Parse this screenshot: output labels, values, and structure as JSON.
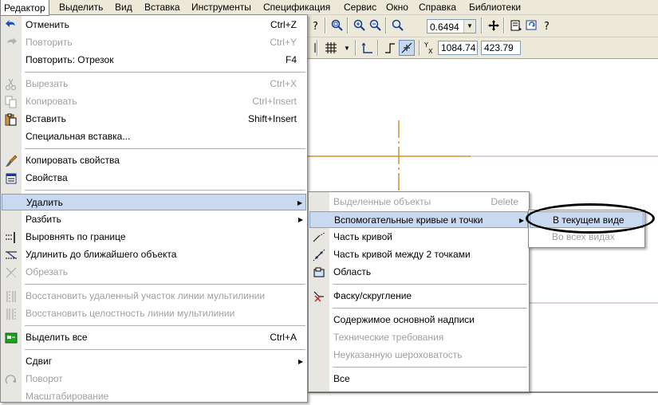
{
  "menubar": {
    "items": [
      "Редактор",
      "Выделить",
      "Вид",
      "Вставка",
      "Инструменты",
      "Спецификация",
      "Сервис",
      "Окно",
      "Справка",
      "Библиотеки"
    ]
  },
  "toolbar": {
    "zoom_value": "0.6494",
    "coord_x": "1084.74",
    "coord_y": "423.79"
  },
  "editor_menu": {
    "items": [
      {
        "label": "Отменить",
        "shortcut": "Ctrl+Z",
        "icon": "undo-icon"
      },
      {
        "label": "Повторить",
        "shortcut": "Ctrl+Y",
        "icon": "redo-icon"
      },
      {
        "label": "Повторить: Отрезок",
        "shortcut": "F4"
      },
      {
        "label": "Вырезать",
        "shortcut": "Ctrl+X",
        "icon": "cut-icon"
      },
      {
        "label": "Копировать",
        "shortcut": "Ctrl+Insert",
        "icon": "copy-icon"
      },
      {
        "label": "Вставить",
        "shortcut": "Shift+Insert",
        "icon": "paste-icon"
      },
      {
        "label": "Специальная вставка..."
      },
      {
        "label": "Копировать свойства",
        "icon": "brush-icon"
      },
      {
        "label": "Свойства",
        "icon": "properties-icon"
      },
      {
        "label": "Удалить"
      },
      {
        "label": "Разбить"
      },
      {
        "label": "Выровнять по границе",
        "icon": "align-boundary-icon"
      },
      {
        "label": "Удлинить до ближайшего объекта",
        "icon": "extend-icon"
      },
      {
        "label": "Обрезать",
        "icon": "trim-icon"
      },
      {
        "label": "Восстановить удаленный участок линии мультилинии",
        "icon": "restore-segment-icon"
      },
      {
        "label": "Восстановить целостность линии мультилинии",
        "icon": "restore-integrity-icon"
      },
      {
        "label": "Выделить все",
        "shortcut": "Ctrl+A",
        "icon": "select-all-icon"
      },
      {
        "label": "Сдвиг"
      },
      {
        "label": "Поворот",
        "icon": "rotate-icon"
      },
      {
        "label": "Масштабирование"
      }
    ]
  },
  "delete_menu": {
    "items": [
      {
        "label": "Выделенные объекты",
        "shortcut": "Delete"
      },
      {
        "label": "Вспомогательные кривые и точки"
      },
      {
        "label": "Часть кривой",
        "icon": "curve-part-icon"
      },
      {
        "label": "Часть кривой между 2 точками",
        "icon": "curve-between-points-icon"
      },
      {
        "label": "Область",
        "icon": "area-icon"
      },
      {
        "label": "Фаску/скругление",
        "icon": "chamfer-icon"
      },
      {
        "label": "Содержимое основной надписи"
      },
      {
        "label": "Технические требования"
      },
      {
        "label": "Неуказанную шероховатость"
      },
      {
        "label": "Все"
      }
    ]
  },
  "aux_menu": {
    "items": [
      {
        "label": "В текущем виде"
      },
      {
        "label": "Во всех видах"
      }
    ]
  },
  "colors": {
    "highlight": "#c8d9f0",
    "crosshair": "#d09030",
    "disabled_text": "#a0a0a0"
  }
}
